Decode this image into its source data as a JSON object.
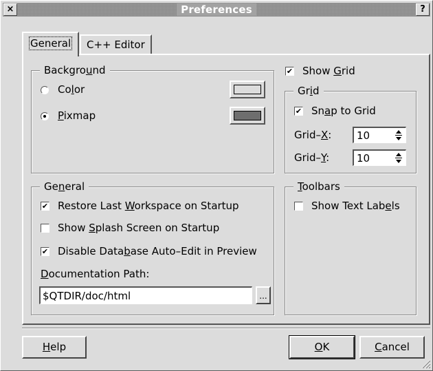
{
  "window": {
    "title": "Preferences",
    "close_glyph": "×",
    "help_glyph": "?"
  },
  "tabs": [
    {
      "label": "General"
    },
    {
      "label": "C++ Editor"
    }
  ],
  "background_group": {
    "title_pre": "Backgro",
    "title_ul": "u",
    "title_post": "nd",
    "color_option": {
      "pre": "Co",
      "ul": "l",
      "post": "or",
      "selected": false,
      "swatch": "#dcdcdc"
    },
    "pixmap_option": {
      "pre": "",
      "ul": "P",
      "post": "ixmap",
      "selected": true,
      "swatch": "#6e6e6e"
    }
  },
  "show_grid": {
    "pre": "Show ",
    "ul": "G",
    "post": "rid",
    "checked": true
  },
  "grid_group": {
    "title_pre": "Gr",
    "title_ul": "i",
    "title_post": "d",
    "snap": {
      "pre": "Sn",
      "ul": "a",
      "post": "p to Grid",
      "checked": true
    },
    "grid_x": {
      "pre": "Grid–",
      "ul": "X",
      "post": ":",
      "value": "10"
    },
    "grid_y": {
      "pre": "Grid–",
      "ul": "Y",
      "post": ":",
      "value": "10"
    }
  },
  "general_group": {
    "title_pre": "Ge",
    "title_ul": "n",
    "title_post": "eral",
    "restore": {
      "pre": "Restore Last ",
      "ul": "W",
      "post": "orkspace on Startup",
      "checked": true
    },
    "splash": {
      "pre": "Show ",
      "ul": "S",
      "post": "plash Screen on Startup",
      "checked": false
    },
    "disable": {
      "pre": "Disable Data",
      "ul": "b",
      "post": "ase Auto–Edit in Preview",
      "checked": true
    },
    "doc_label": {
      "pre": "",
      "ul": "D",
      "post": "ocumentation Path:"
    },
    "doc_path": "$QTDIR/doc/html",
    "browse_label": "..."
  },
  "toolbars_group": {
    "title_pre": "",
    "title_ul": "T",
    "title_post": "oolbars",
    "show_text": {
      "pre": "Show Text Lab",
      "ul": "e",
      "post": "ls",
      "checked": false
    }
  },
  "buttons": {
    "help": {
      "pre": "",
      "ul": "H",
      "post": "elp"
    },
    "ok": {
      "pre": "",
      "ul": "O",
      "post": "K"
    },
    "cancel": {
      "pre": "",
      "ul": "C",
      "post": "ancel"
    }
  },
  "check_glyph": "✔"
}
